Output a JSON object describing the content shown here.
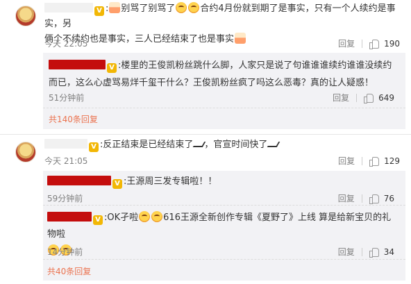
{
  "comments": [
    {
      "text_a": "别骂了别骂了",
      "text_b": "合约4月份就到期了是事实，只有一个人续约是事实，另",
      "text_c": "俩个不续约也是事实，三人已经结束了也是事实",
      "time": "今天 22:05",
      "reply_label": "回复",
      "like_count": "190",
      "replies": [
        {
          "text_line1": "楼里的王俊凯粉丝跳什么脚，人家只是说了句谁谁谁续约谁谁没续约",
          "text_line2": "而已，这么心虚骂易烊千玺干什么？王俊凯粉丝疯了吗这么恶毒？真的让人疑惑！",
          "time": "51分钟前",
          "reply_label": "回复",
          "like_count": "649"
        }
      ],
      "more": "共140条回复"
    },
    {
      "text": "反正结束是已经结束了",
      "text_b": "，官宣时间快了",
      "time": "今天 21:05",
      "reply_label": "回复",
      "like_count": "129",
      "replies": [
        {
          "text": "王源周三发专辑啦！！",
          "time": "59分钟前",
          "reply_label": "回复",
          "like_count": "76"
        },
        {
          "text_a": "OK孑啦",
          "text_b": "616王源全新创作专辑《夏野了》上线 算是给新宝贝的礼物啦",
          "time": "14分钟前",
          "reply_label": "回复",
          "like_count": "34"
        }
      ],
      "more": "共40条回复"
    }
  ],
  "icons": {
    "like": "thumbs-up-icon",
    "vip": "vip-badge-icon",
    "emoji": "smile-emoji-icon"
  },
  "colors": {
    "accent": "#eb7350",
    "username_redacted": "#c40d0d",
    "reply_bg": "#f2f2f5"
  }
}
